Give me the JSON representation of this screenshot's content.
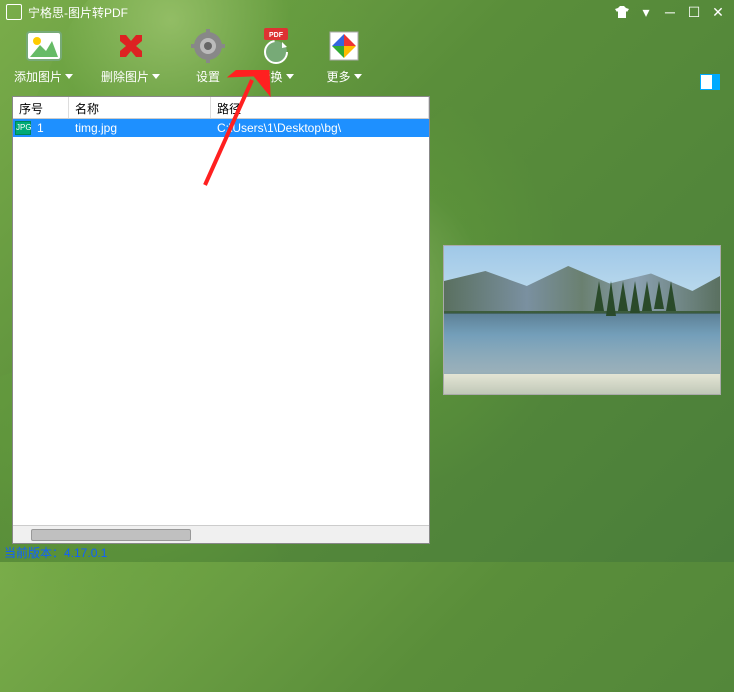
{
  "window": {
    "title": "宁格思-图片转PDF"
  },
  "toolbar": {
    "add_image": "添加图片",
    "delete_image": "删除图片",
    "settings": "设置",
    "convert": "转换",
    "more": "更多"
  },
  "table": {
    "headers": {
      "seq": "序号",
      "name": "名称",
      "path": "路径"
    },
    "rows": [
      {
        "seq": "1",
        "name": "timg.jpg",
        "path": "C:\\Users\\1\\Desktop\\bg\\",
        "file_type": "JPG"
      }
    ]
  },
  "statusbar": {
    "version_label": "当前版本：4.17.0.1"
  }
}
